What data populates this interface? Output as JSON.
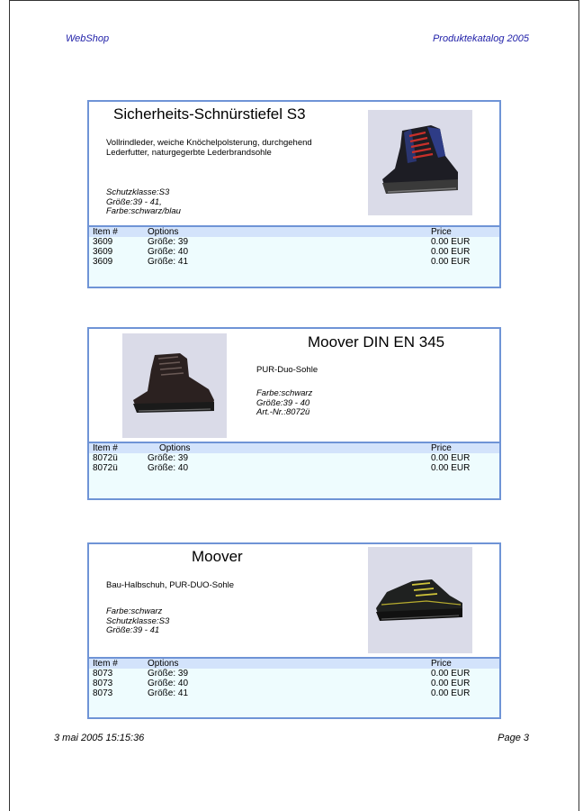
{
  "header": {
    "left": "WebShop",
    "right": "Produktekatalog 2005"
  },
  "footer": {
    "date": "3 mai 2005 15:15:36",
    "page": "Page 3"
  },
  "table_headers": {
    "item": "Item #",
    "options": "Options",
    "price": "Price"
  },
  "products": [
    {
      "title": "Sicherheits-Schnürstiefel S3",
      "description": "Vollrindleder, weiche Knöchelpolsterung, durchgehend Lederfutter, naturgegerbte Lederbrandsohle",
      "attributes": [
        "Schutzklasse:S3",
        "Größe:39 - 41,",
        "Farbe:schwarz/blau"
      ],
      "image_icon": "high-boot-blue-red-laces-icon",
      "rows": [
        {
          "item": "3609",
          "option": "Größe: 39",
          "price": "0.00 EUR"
        },
        {
          "item": "3609",
          "option": "Größe: 40",
          "price": "0.00 EUR"
        },
        {
          "item": "3609",
          "option": "Größe: 41",
          "price": "0.00 EUR"
        }
      ]
    },
    {
      "title": "Moover DIN EN 345",
      "description": "PUR-Duo-Sohle",
      "attributes": [
        "Farbe:schwarz",
        "Größe:39 - 40",
        "Art.-Nr.:8072ü"
      ],
      "image_icon": "high-boot-black-icon",
      "rows": [
        {
          "item": "8072ü",
          "option": "Größe: 39",
          "price": "0.00 EUR"
        },
        {
          "item": "8072ü",
          "option": "Größe: 40",
          "price": "0.00 EUR"
        }
      ]
    },
    {
      "title": "Moover",
      "description": "Bau-Halbschuh, PUR-DUO-Sohle",
      "attributes": [
        "Farbe:schwarz",
        "Schutzklasse:S3",
        "Größe:39 - 41"
      ],
      "image_icon": "low-shoe-black-yellow-icon",
      "rows": [
        {
          "item": "8073",
          "option": "Größe: 39",
          "price": "0.00 EUR"
        },
        {
          "item": "8073",
          "option": "Größe: 40",
          "price": "0.00 EUR"
        },
        {
          "item": "8073",
          "option": "Größe: 41",
          "price": "0.00 EUR"
        }
      ]
    }
  ],
  "colors": {
    "border": "#6f94d6",
    "header_bg": "#d3e3fb",
    "table_bg": "#eefcfe",
    "header_text": "#1f1fa8"
  }
}
